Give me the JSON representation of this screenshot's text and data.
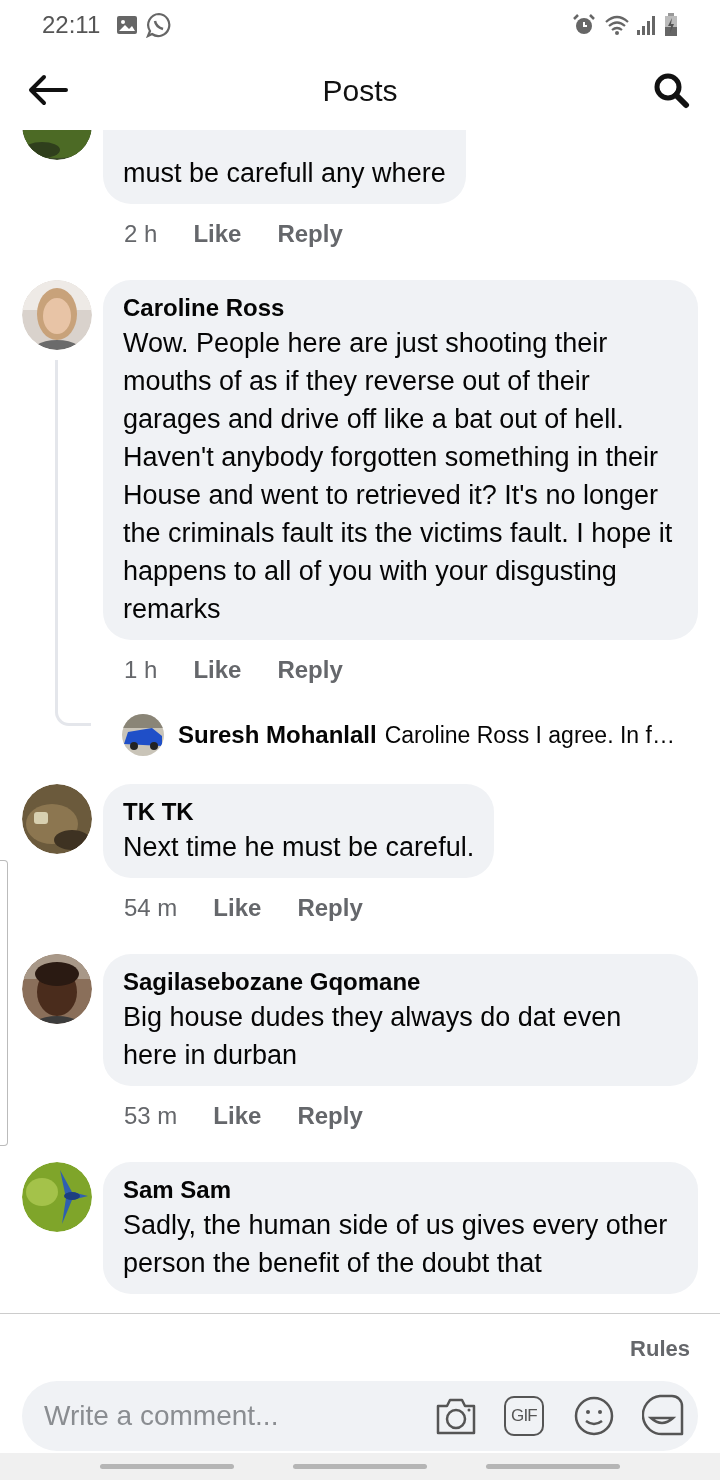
{
  "status_bar": {
    "time": "22:11"
  },
  "header": {
    "title": "Posts"
  },
  "comments": [
    {
      "text": "must be carefull any where",
      "time": "2 h",
      "like": "Like",
      "reply": "Reply"
    },
    {
      "author": "Caroline Ross",
      "text": "Wow. People here are just shooting their mouths of as if they reverse out of their garages and drive off like a bat out of hell. Haven't anybody forgotten something in their House and went to retrieved it? It's no longer the criminals fault its the victims fault. I hope it happens to all of you with your disgusting remarks",
      "time": "1 h",
      "like": "Like",
      "reply": "Reply",
      "replies": [
        {
          "author": "Suresh Mohanlall",
          "text": "Caroline Ross I agree. In f…"
        }
      ]
    },
    {
      "author": "TK TK",
      "text": "Next time he must be careful.",
      "time": "54 m",
      "like": "Like",
      "reply": "Reply"
    },
    {
      "author": "Sagilasebozane Gqomane",
      "text": "Big house dudes they always do dat even here in durban",
      "time": "53 m",
      "like": "Like",
      "reply": "Reply"
    },
    {
      "author": "Sam Sam",
      "text": "Sadly, the human side of us gives every other person the benefit of the doubt that"
    }
  ],
  "composer": {
    "rules": "Rules",
    "placeholder": "Write a comment...",
    "gif": "GIF"
  }
}
